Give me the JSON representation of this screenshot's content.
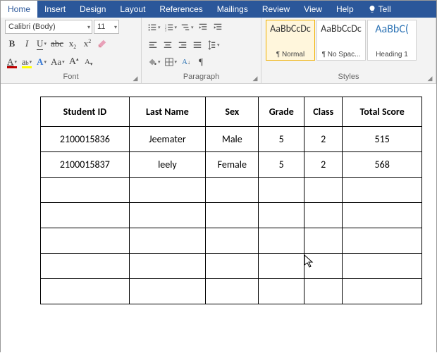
{
  "tabs": {
    "items": [
      "Home",
      "Insert",
      "Design",
      "Layout",
      "References",
      "Mailings",
      "Review",
      "View",
      "Help"
    ],
    "tell": "Tell",
    "active": "Home"
  },
  "font": {
    "name": "Calibri (Body)",
    "size": "11",
    "group_label": "Font"
  },
  "paragraph": {
    "group_label": "Paragraph"
  },
  "styles": {
    "group_label": "Styles",
    "items": [
      {
        "preview": "AaBbCcDc",
        "name": "¶ Normal"
      },
      {
        "preview": "AaBbCcDc",
        "name": "¶ No Spac..."
      },
      {
        "preview": "AaBbC(",
        "name": "Heading 1"
      }
    ]
  },
  "table": {
    "headers": [
      "Student ID",
      "Last Name",
      "Sex",
      "Grade",
      "Class",
      "Total Score"
    ],
    "rows": [
      [
        "2100015836",
        "Jeemater",
        "Male",
        "5",
        "2",
        "515"
      ],
      [
        "2100015837",
        "leely",
        "Female",
        "5",
        "2",
        "568"
      ],
      [
        "",
        "",
        "",
        "",
        "",
        ""
      ],
      [
        "",
        "",
        "",
        "",
        "",
        ""
      ],
      [
        "",
        "",
        "",
        "",
        "",
        ""
      ],
      [
        "",
        "",
        "",
        "",
        "",
        ""
      ],
      [
        "",
        "",
        "",
        "",
        "",
        ""
      ]
    ]
  }
}
